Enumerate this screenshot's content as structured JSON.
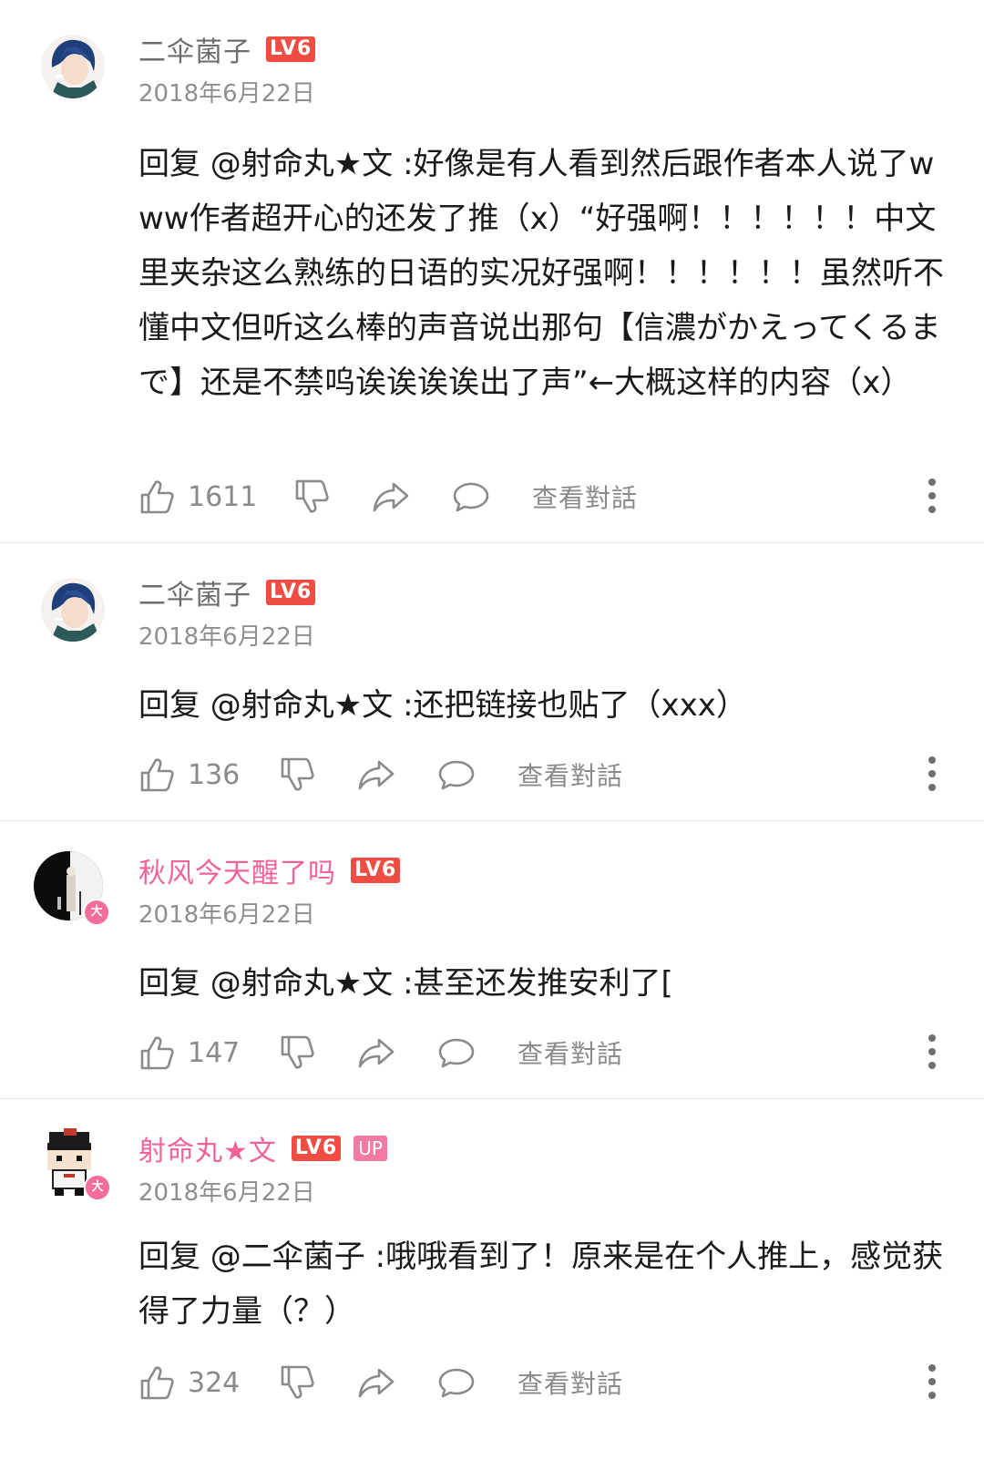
{
  "comments": [
    {
      "username": "二伞菌子",
      "level": "LV6",
      "date": "2018年6月22日",
      "text": "回复 @射命丸★文 :好像是有人看到然后跟作者本人说了www作者超开心的还发了推（x）“好强啊！！！！！！中文里夹杂这么熟练的日语的实况好强啊！！！！！！虽然听不懂中文但听这么棒的声音说出那句【信濃がかえってくるまで】还是不禁呜诶诶诶诶出了声”←大概这样的内容（x）",
      "likes": "1611",
      "view_conversation": "查看對話"
    },
    {
      "username": "二伞菌子",
      "level": "LV6",
      "date": "2018年6月22日",
      "text": "回复 @射命丸★文 :还把链接也贴了（xxx）",
      "likes": "136",
      "view_conversation": "查看對話"
    },
    {
      "username": "秋风今天醒了吗",
      "level": "LV6",
      "avatar_badge": "大",
      "date": "2018年6月22日",
      "text": "回复 @射命丸★文 :甚至还发推安利了[",
      "likes": "147",
      "view_conversation": "查看對話"
    },
    {
      "username": "射命丸★文",
      "level": "LV6",
      "up_badge": "UP",
      "avatar_badge": "大",
      "date": "2018年6月22日",
      "text": "回复 @二伞菌子 :哦哦看到了！原来是在个人推上，感觉获得了力量（？）",
      "likes": "324",
      "view_conversation": "查看對話"
    }
  ],
  "icons": {
    "like": "thumb-up-icon",
    "dislike": "thumb-down-icon",
    "share": "share-icon",
    "reply": "comment-bubble-icon",
    "more": "more-vertical-icon"
  },
  "colors": {
    "vip_name": "#f2629a",
    "level_badge": "#ee4d44",
    "up_badge": "#f27aa4",
    "meta_gray": "#8f8f8f"
  }
}
